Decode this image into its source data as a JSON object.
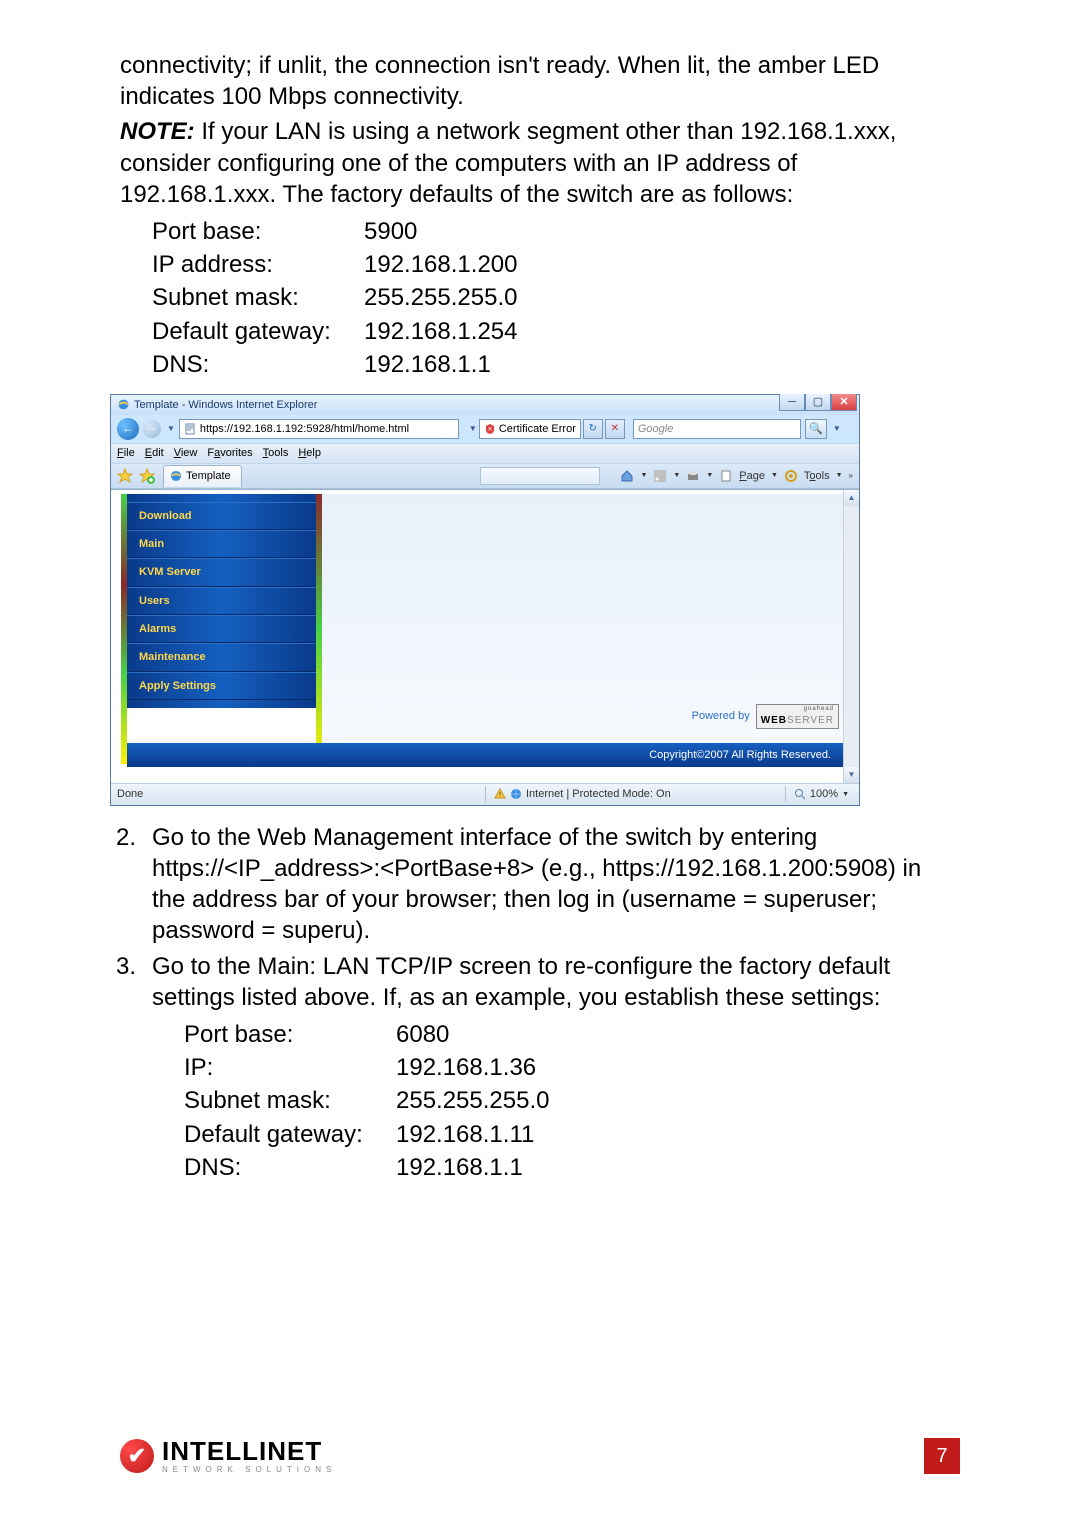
{
  "intro_para": "connectivity; if unlit, the connection isn't ready. When lit, the amber LED indicates 100 Mbps connectivity.",
  "note_label": "NOTE:",
  "note_body": " If your LAN is using a network segment other than 192.168.1.xxx, consider configuring one of the computers with an IP address of 192.168.1.xxx. The factory defaults of the switch are as follows:",
  "defaults": [
    {
      "k": "Port base:",
      "v": "5900"
    },
    {
      "k": "IP address:",
      "v": "192.168.1.200"
    },
    {
      "k": "Subnet mask:",
      "v": "255.255.255.0"
    },
    {
      "k": "Default gateway:",
      "v": "192.168.1.254"
    },
    {
      "k": "DNS:",
      "v": "192.168.1.1"
    }
  ],
  "browser": {
    "title": "Template - Windows Internet Explorer",
    "url": "https://192.168.1.192:5928/html/home.html",
    "cert_error": "Certificate Error",
    "search_placeholder": "Google",
    "menu": [
      "File",
      "Edit",
      "View",
      "Favorites",
      "Tools",
      "Help"
    ],
    "tab_label": "Template",
    "toolbar_page": "Page",
    "toolbar_tools": "Tools",
    "sidebar": [
      "Download",
      "Main",
      "KVM Server",
      "Users",
      "Alarms",
      "Maintenance",
      "Apply Settings"
    ],
    "powered_by": "Powered by",
    "webserver_brand_a": "WEB",
    "webserver_brand_b": "SERVER",
    "webserver_tag": "goahead",
    "copyright": "Copyright©2007  All Rights Reserved.",
    "status_left": "Done",
    "status_center": "Internet | Protected Mode: On",
    "status_zoom": "100%"
  },
  "step2": {
    "num": "2.",
    "text": "Go to the Web Management interface of the switch by entering https://<IP_address>:<PortBase+8> (e.g., https://192.168.1.200:5908) in the address bar of your browser; then log in (username = superuser; password = superu)."
  },
  "step3": {
    "num": "3.",
    "lead": "Go to the Main: LAN TCP/IP screen to re-configure the factory default settings listed above. If, as an example, you establish these settings:",
    "settings": [
      {
        "k": "Port base:",
        "v": "6080"
      },
      {
        "k": "IP:",
        "v": "192.168.1.36"
      },
      {
        "k": "Subnet mask:",
        "v": "255.255.255.0"
      },
      {
        "k": "Default gateway:",
        "v": "192.168.1.11"
      },
      {
        "k": "DNS:",
        "v": "192.168.1.1"
      }
    ]
  },
  "footer": {
    "brand": "INTELLINET",
    "tag": "NETWORK SOLUTIONS",
    "page_num": "7"
  }
}
